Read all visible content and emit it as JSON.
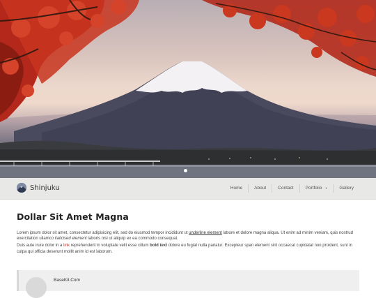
{
  "hero": {
    "image": "mountain-autumn-landscape"
  },
  "brand": {
    "logo_icon": "mountain-logo-icon",
    "name": "Shinjuku"
  },
  "nav": {
    "home": "Home",
    "about": "About",
    "contact": "Contact",
    "portfolio": "Portfolio",
    "portfolio_caret": "▼",
    "gallery": "Gallery"
  },
  "main": {
    "title": "Dollar Sit Amet Magna",
    "p1": {
      "a": "Lorem ipsum dolor sit amet, consectetur adipisicing elit, sed do eiusmod tempor incididunt ut ",
      "underline": "underline element",
      "b": " labore et dolore magna aliqua. Ut enim ad minim veniam, quis nostrud exercitation ullamco ",
      "italic": "italicised element",
      "c": " laboris nisi ut aliquip ex ea commodo consequat."
    },
    "p2": {
      "a": "Duis aute irure dolor in a ",
      "link": "link",
      "b": " reprehenderit in voluptate velit esse cillum ",
      "bold": "bold text",
      "c": " dolore eu fugiat nulla pariatur. Excepteur span element sint occaecat cupidatat non proident, sunt in culpa qui officia deserunt mollit anim id est laborum."
    }
  },
  "quote": {
    "author": "BaseKit.Com"
  },
  "colors": {
    "navbar_bg": "#e8e8e6",
    "link": "#c0392b",
    "foliage": "#c0301c"
  }
}
